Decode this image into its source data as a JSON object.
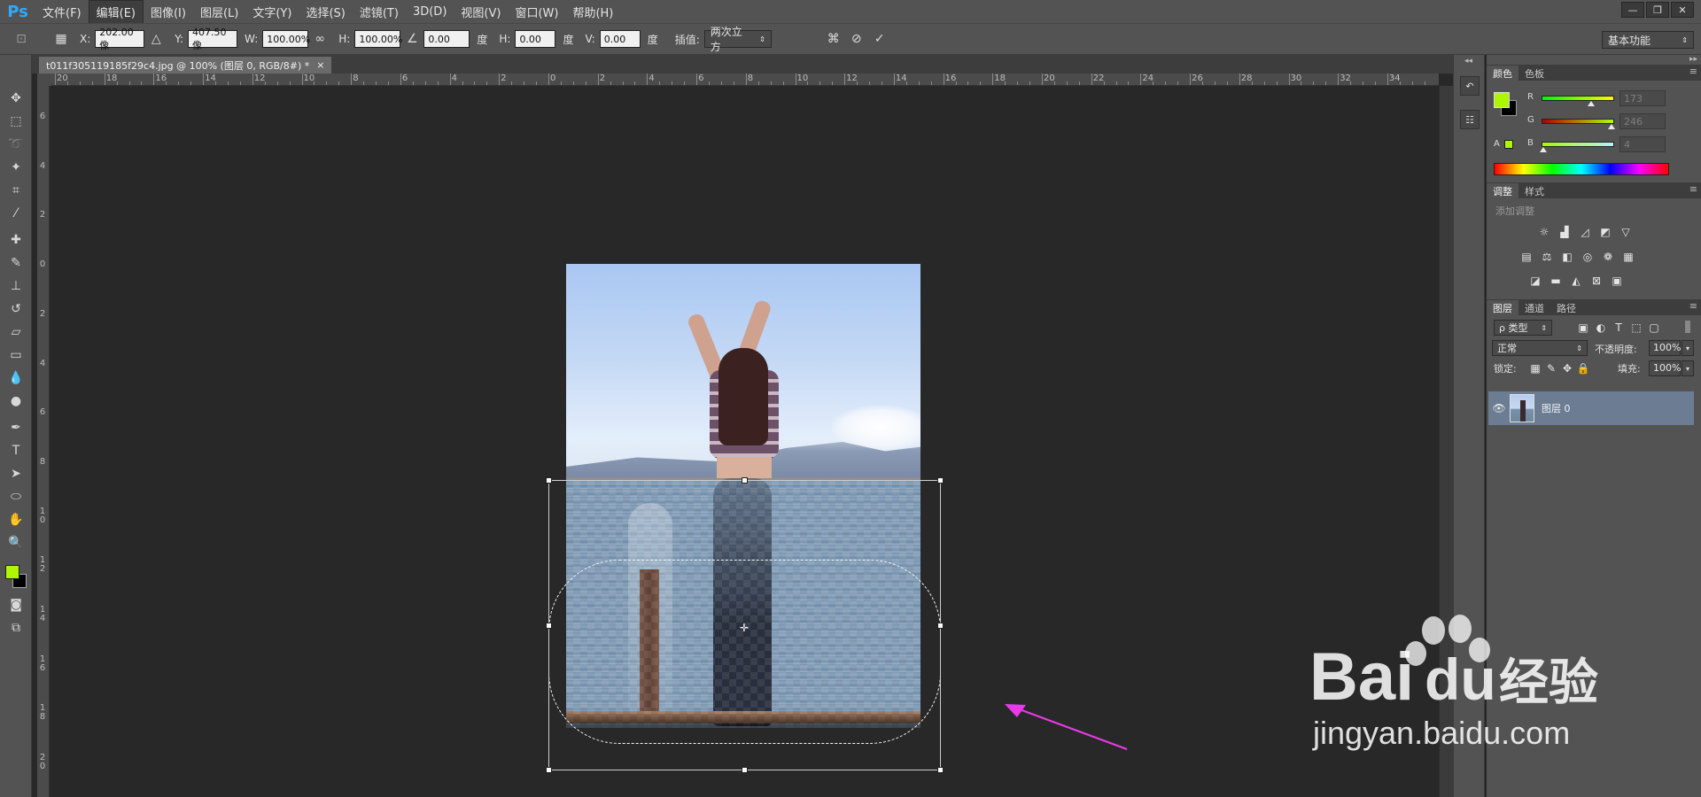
{
  "app": {
    "logo": "Ps"
  },
  "menu": [
    "文件(F)",
    "编辑(E)",
    "图像(I)",
    "图层(L)",
    "文字(Y)",
    "选择(S)",
    "滤镜(T)",
    "3D(D)",
    "视图(V)",
    "窗口(W)",
    "帮助(H)"
  ],
  "menu_active_index": 1,
  "window_controls": [
    "—",
    "❐",
    "✕"
  ],
  "options": {
    "x_label": "X:",
    "x_value": "202.00 像",
    "y_label": "Y:",
    "y_value": "407.50 像",
    "w_label": "W:",
    "w_value": "100.00%",
    "h_label": "H:",
    "h_value": "100.00%",
    "angle_value": "0.00",
    "angle_unit": "度",
    "hskew_label": "H:",
    "hskew_value": "0.00",
    "hskew_unit": "度",
    "vskew_label": "V:",
    "vskew_value": "0.00",
    "vskew_unit": "度",
    "interp_label": "插值:",
    "interp_value": "两次立方",
    "workspace": "基本功能"
  },
  "document": {
    "tab_title": "t011f305119185f29c4.jpg @ 100% (图层 0, RGB/8#) *",
    "tab_close": "×"
  },
  "ruler_h_labels": [
    "20",
    "18",
    "16",
    "14",
    "12",
    "10",
    "8",
    "6",
    "4",
    "2",
    "0",
    "2",
    "4",
    "6",
    "8",
    "10",
    "12",
    "14",
    "16",
    "18",
    "20",
    "22",
    "24",
    "26",
    "28",
    "30",
    "32",
    "34"
  ],
  "ruler_v_labels": [
    "6",
    "4",
    "2",
    "0",
    "2",
    "4",
    "6",
    "8",
    "10",
    "12",
    "14",
    "16",
    "18",
    "20"
  ],
  "color_panel": {
    "tabs": [
      "颜色",
      "色板"
    ],
    "foreground": "#ADF604",
    "background": "#000000",
    "r_label": "R",
    "r_value": "173",
    "g_label": "G",
    "g_value": "246",
    "b_label": "B",
    "b_value": "4",
    "r_level": 0.68,
    "g_level": 0.96,
    "b_level": 0.02
  },
  "adjustments_panel": {
    "tabs": [
      "调整",
      "样式"
    ],
    "header": "添加调整",
    "icons_row1": [
      "brightness-icon",
      "levels-icon",
      "curves-icon",
      "exposure-icon",
      "vibrance-icon"
    ],
    "icons_row2": [
      "hue-sat-icon",
      "color-balance-icon",
      "bw-icon",
      "photo-filter-icon",
      "channel-mixer-icon",
      "color-lookup-icon"
    ],
    "icons_row3": [
      "invert-icon",
      "posterize-icon",
      "threshold-icon",
      "selective-color-icon",
      "gradient-map-icon"
    ]
  },
  "layers_panel": {
    "tabs": [
      "图层",
      "通道",
      "路径"
    ],
    "filter_kind": "ρ 类型",
    "blend_mode": "正常",
    "opacity_label": "不透明度:",
    "opacity_value": "100%",
    "lock_label": "锁定:",
    "fill_label": "填充:",
    "fill_value": "100%",
    "layers": [
      {
        "name": "图层 0",
        "visible": true
      }
    ]
  },
  "watermark": {
    "brand": "Bai",
    "brand_cn": "经验",
    "url": "jingyan.baidu.com"
  },
  "colors": {
    "accent_arrow": "#e83be8",
    "ps_blue": "#31a8ff"
  }
}
